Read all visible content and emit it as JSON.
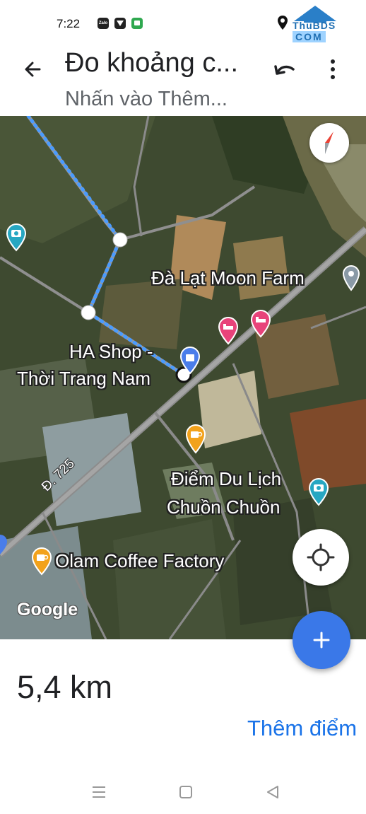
{
  "status_bar": {
    "time": "7:22",
    "app_icons": [
      "zalo-icon",
      "shield-icon",
      "message-icon"
    ],
    "zalo_label": "Zalo",
    "right_icons": [
      "location-icon"
    ]
  },
  "watermark": {
    "line1": "ThuBDS",
    "line2": "COM"
  },
  "app_bar": {
    "title": "Đo khoảng c...",
    "subtitle": "Nhấn vào Thêm..."
  },
  "map": {
    "labels": {
      "moon_farm": "Đà Lạt Moon Farm",
      "ha_shop_line1": "HA Shop -",
      "ha_shop_line2": "Thời Trang Nam",
      "chuon_line1": "Điểm Du Lịch",
      "chuon_line2": "Chuồn Chuồn",
      "olam": "Olam Coffee Factory",
      "road": "Đ. 725",
      "google": "Google"
    },
    "colors": {
      "route": "#4a9bff",
      "hotel_pin": "#e8437a",
      "cafe_pin": "#f2a21b",
      "camera_pin": "#27a7c2",
      "shop_pin": "#4a7dea",
      "accent": "#1a73e8"
    }
  },
  "measurement": {
    "distance": "5,4 km",
    "add_point_label": "Thêm điểm"
  },
  "nav_bar": {
    "buttons": [
      "menu-icon",
      "home-icon",
      "back-triangle-icon"
    ]
  }
}
